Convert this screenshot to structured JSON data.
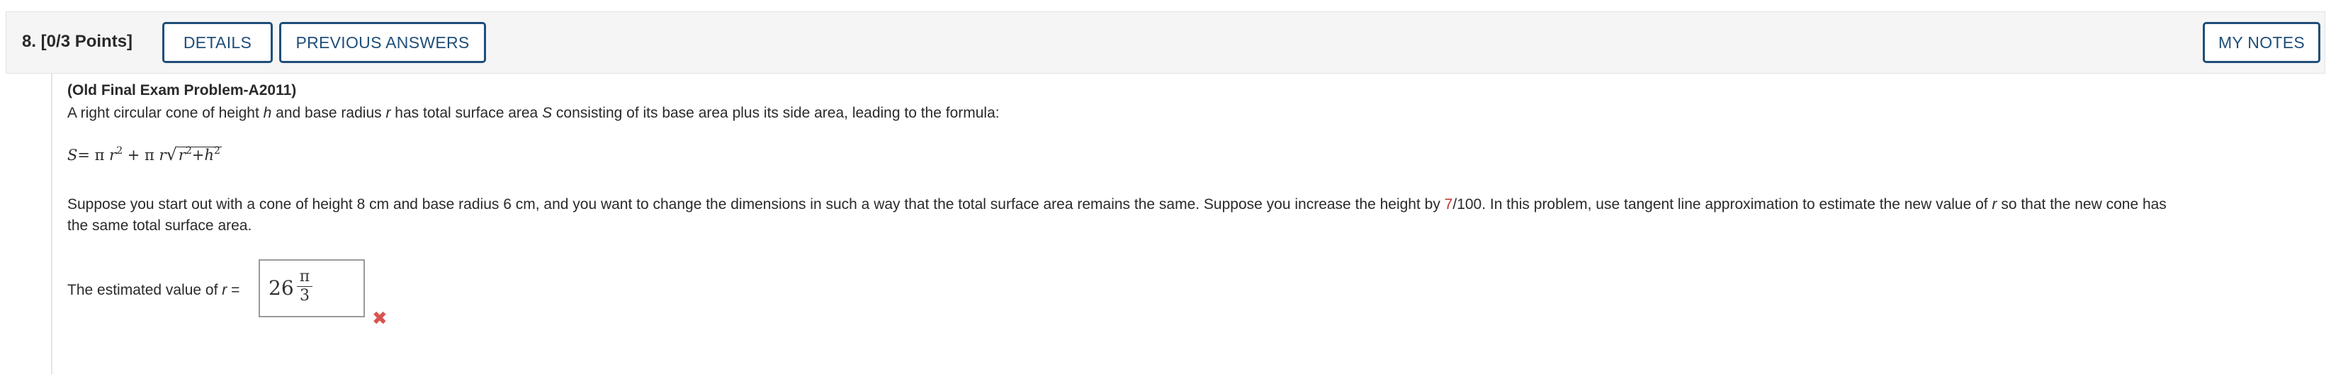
{
  "header": {
    "question_label": "8.  [0/3 Points]",
    "details_label": "DETAILS",
    "previous_answers_label": "PREVIOUS ANSWERS",
    "my_notes_label": "MY NOTES"
  },
  "problem": {
    "title": "(Old Final Exam Problem-A2011)",
    "intro_before_h": "A right circular cone of height ",
    "var_h": "h",
    "intro_and_radius": " and base radius ",
    "var_r": "r",
    "intro_has_total": " has total surface area ",
    "var_S": "S",
    "intro_rest": " consisting of its base area plus its side area, leading to the formula:",
    "formula": {
      "S": "S",
      "eq_pi": "= π ",
      "r1": "r",
      "exp2a": "2",
      "plus_pi": " + π ",
      "r2": "r",
      "sqrt": "√",
      "r3": "r",
      "exp2b": "2",
      "plus": "+",
      "h": "h",
      "exp2c": "2"
    },
    "para_line1_a": "Suppose you start out with a cone of height 8 cm and base radius 6 cm, and you want to change the dimensions in such a way that the total surface area remains the same. Suppose you increase the height by ",
    "para_highlight": "7",
    "para_line1_b": "/100. In this problem, use tangent line approximation to estimate the new value of ",
    "para_var_r": "r",
    "para_line1_c": " so that the new cone has",
    "para_line2": "the same total surface area."
  },
  "answer": {
    "label_prefix": "The estimated value of ",
    "label_var": "r",
    "label_suffix": " =",
    "whole": "26",
    "numerator": "π",
    "denominator": "3",
    "status_icon": "wrong-x-icon",
    "status_mark": "✖"
  },
  "colors": {
    "button_border": "#1f4e79",
    "highlight_red": "#c0392b",
    "wrong_red": "#d9534f",
    "header_bg": "#f5f5f5"
  }
}
